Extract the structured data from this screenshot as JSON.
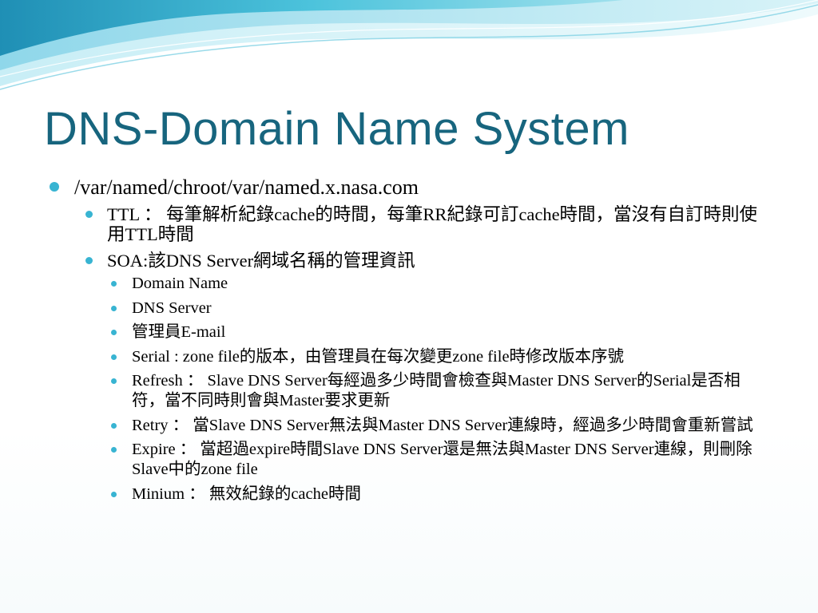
{
  "slide": {
    "title": "DNS-Domain Name System",
    "accent_color": "#17657e",
    "bullet_color": "#38b4d2",
    "bullets": [
      {
        "text": "/var/named/chroot/var/named.x.nasa.com",
        "children": [
          {
            "text": "TTL ： 每筆解析紀錄cache的時間，每筆RR紀錄可訂cache時間，當沒有自訂時則使用TTL時間",
            "children": []
          },
          {
            "text": "SOA:該DNS Server網域名稱的管理資訊",
            "children": [
              {
                "text": "Domain Name"
              },
              {
                "text": "DNS Server"
              },
              {
                "text": "管理員E-mail"
              },
              {
                "text": "Serial : zone file的版本，由管理員在每次變更zone file時修改版本序號"
              },
              {
                "text": "Refresh ： Slave DNS Server每經過多少時間會檢查與Master DNS Server的Serial是否相符，當不同時則會與Master要求更新"
              },
              {
                "text": "Retry ： 當Slave DNS Server無法與Master DNS Server連線時，經過多少時間會重新嘗試"
              },
              {
                "text": "Expire ： 當超過expire時間Slave DNS Server還是無法與Master DNS Server連線，則刪除Slave中的zone file"
              },
              {
                "text": "Minium ： 無效紀錄的cache時間"
              }
            ]
          }
        ]
      }
    ]
  }
}
